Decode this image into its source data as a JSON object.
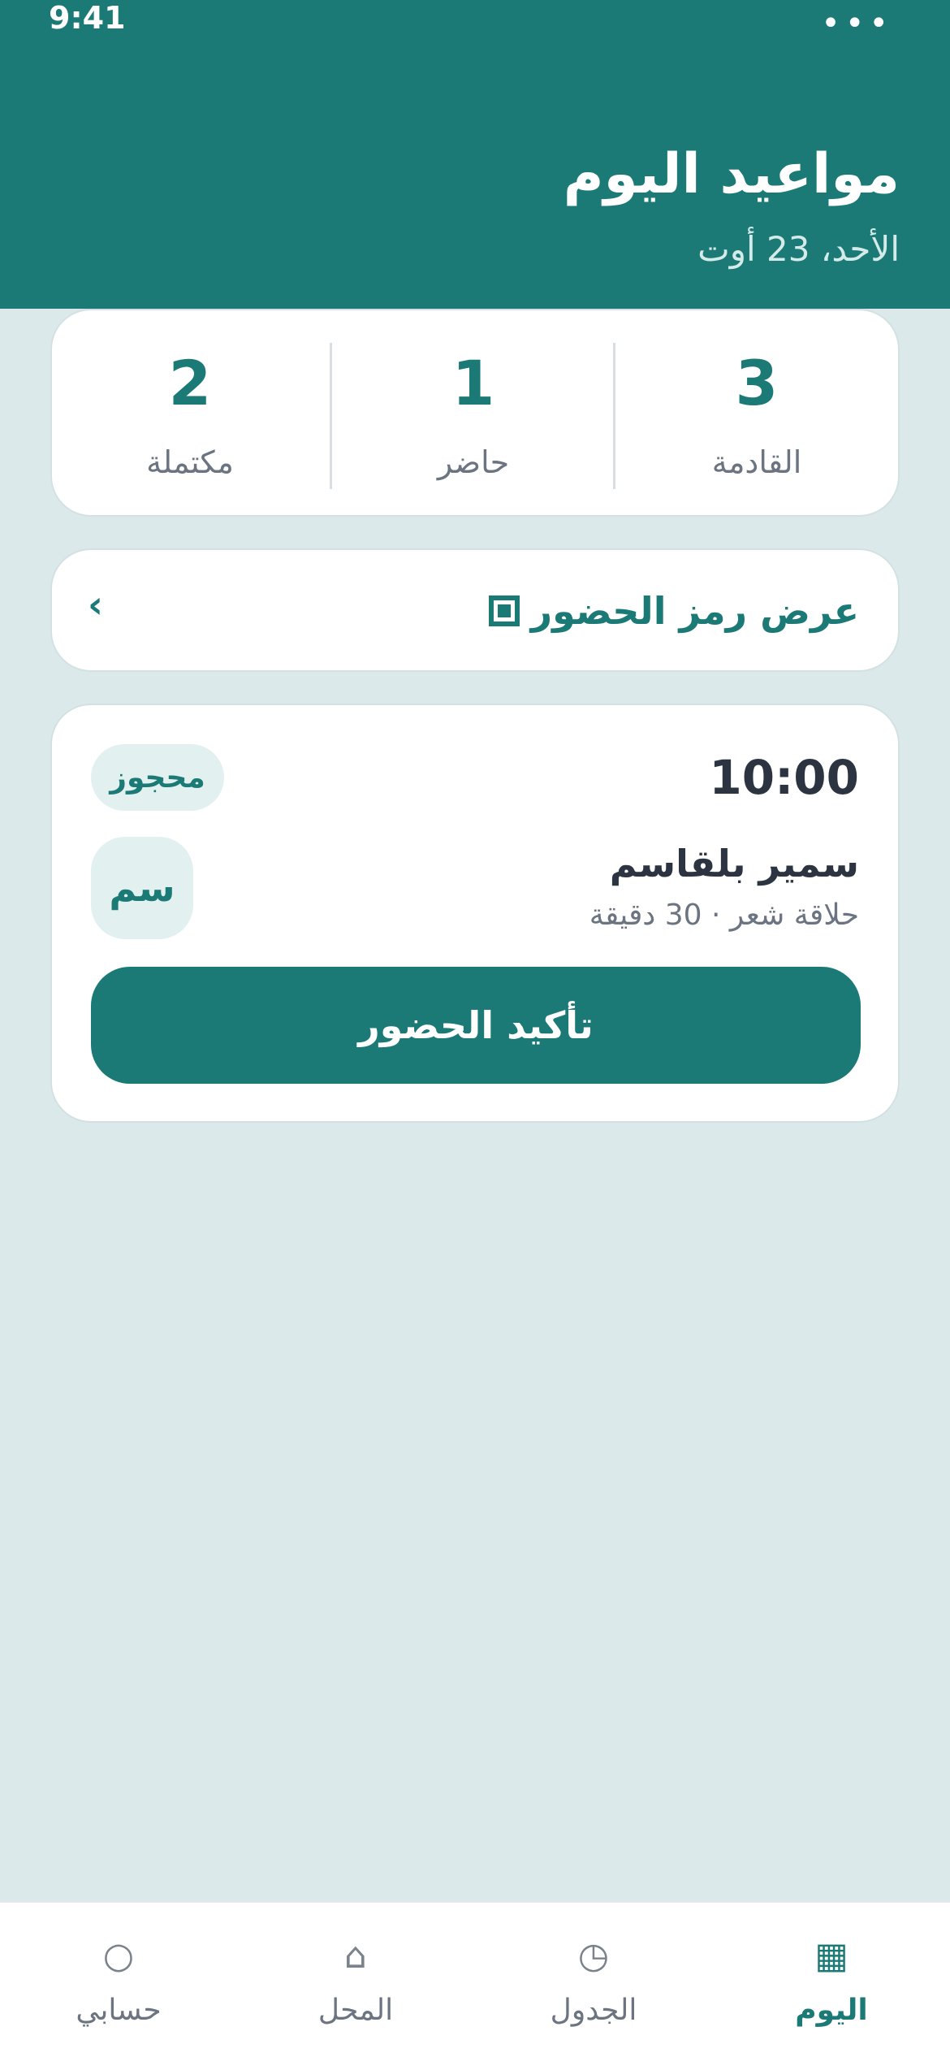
{
  "status_bar": {
    "time": "9:41",
    "menu": "•••"
  },
  "header": {
    "title": "مواعيد اليوم",
    "date": "الأحد، 23 أوت"
  },
  "stats": [
    {
      "value": "3",
      "label": "القادمة"
    },
    {
      "value": "1",
      "label": "حاضر"
    },
    {
      "value": "2",
      "label": "مكتملة"
    }
  ],
  "qr": {
    "label": "عرض رمز الحضور",
    "chevron": "‹"
  },
  "appointment": {
    "time": "10:00",
    "status": "محجوز",
    "name": "سمير بلقاسم",
    "service": "حلاقة شعر · 30 دقيقة",
    "initials": "سم",
    "confirm_label": "تأكيد الحضور"
  },
  "tabs": [
    {
      "label": "اليوم",
      "icon": "▦",
      "icon_name": "calendar-grid-icon",
      "active": true
    },
    {
      "label": "الجدول",
      "icon": "◷",
      "icon_name": "clock-icon",
      "active": false
    },
    {
      "label": "المحل",
      "icon": "⌂",
      "icon_name": "home-icon",
      "active": false
    },
    {
      "label": "حسابي",
      "icon": "○",
      "icon_name": "profile-icon",
      "active": false
    }
  ],
  "colors": {
    "primary": "#1c7a76",
    "background": "#dce9ea",
    "badge_bg": "#e2f1f0"
  }
}
